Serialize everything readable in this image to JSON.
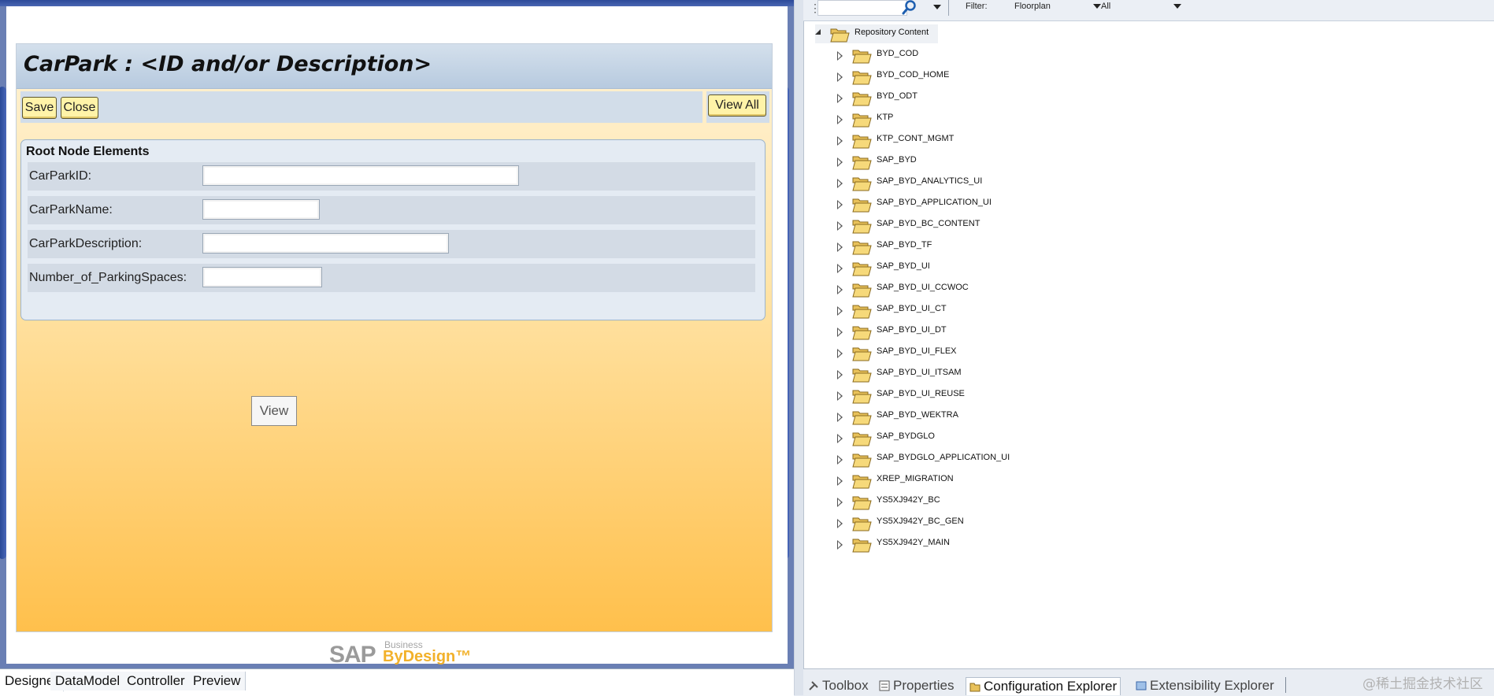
{
  "designer": {
    "title": "CarPark : <ID and/or Description>",
    "toolbar": {
      "save": "Save",
      "close": "Close",
      "view_all": "View All"
    },
    "section_title": "Root Node Elements",
    "fields": [
      {
        "label": "CarParkID:",
        "value": ""
      },
      {
        "label": "CarParkName:",
        "value": ""
      },
      {
        "label": "CarParkDescription:",
        "value": ""
      },
      {
        "label": "Number_of_ParkingSpaces:",
        "value": ""
      }
    ],
    "view_button": "View",
    "logo": {
      "sap": "SAP",
      "business": "Business",
      "bydesign": "ByDesign™"
    }
  },
  "designer_tabs": [
    "Designer",
    "DataModel",
    "Controller",
    "Preview"
  ],
  "explorer": {
    "filter_label": "Filter:",
    "filter_type": "Floorplan",
    "filter_scope": "All",
    "root": "Repository Content",
    "items": [
      "BYD_COD",
      "BYD_COD_HOME",
      "BYD_ODT",
      "KTP",
      "KTP_CONT_MGMT",
      "SAP_BYD",
      "SAP_BYD_ANALYTICS_UI",
      "SAP_BYD_APPLICATION_UI",
      "SAP_BYD_BC_CONTENT",
      "SAP_BYD_TF",
      "SAP_BYD_UI",
      "SAP_BYD_UI_CCWOC",
      "SAP_BYD_UI_CT",
      "SAP_BYD_UI_DT",
      "SAP_BYD_UI_FLEX",
      "SAP_BYD_UI_ITSAM",
      "SAP_BYD_UI_REUSE",
      "SAP_BYD_WEKTRA",
      "SAP_BYDGLO",
      "SAP_BYDGLO_APPLICATION_UI",
      "XREP_MIGRATION",
      "YS5XJ942Y_BC",
      "YS5XJ942Y_BC_GEN",
      "YS5XJ942Y_MAIN"
    ]
  },
  "explorer_tabs": [
    "Toolbox",
    "Properties",
    "Configuration Explorer",
    "Extensibility Explorer"
  ],
  "watermark": "@稀土掘金技术社区",
  "colors": {
    "floorplan_top": "#fff2d4",
    "floorplan_bottom": "#ffc04c",
    "button": "#fff3a8",
    "header": "#b7cadf"
  }
}
